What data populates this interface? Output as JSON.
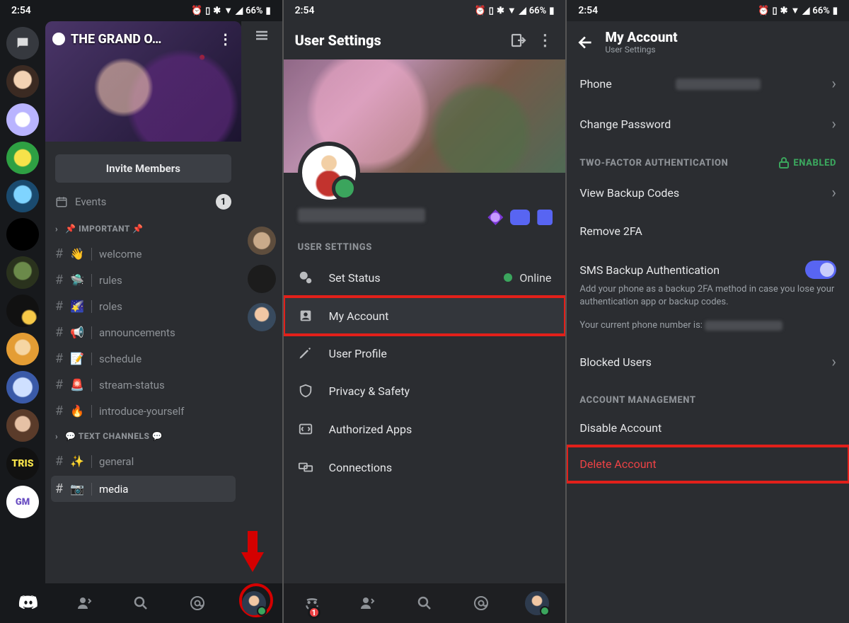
{
  "statusbar": {
    "time": "2:54",
    "battery": "66%",
    "icons": "⏰ ⬚ ✲ ▾◢"
  },
  "panel1": {
    "server_title": "THE GRAND O…",
    "invite": "Invite Members",
    "events_label": "Events",
    "events_count": "1",
    "cat_important": "📌 IMPORTANT 📌",
    "cat_text": "💬 TEXT CHANNELS 💬",
    "ch": {
      "welcome": "welcome",
      "rules": "rules",
      "roles": "roles",
      "announcements": "announcements",
      "schedule": "schedule",
      "stream": "stream-status",
      "intro": "introduce-yourself",
      "general": "general",
      "media": "media"
    },
    "emojis": {
      "welcome": "👋",
      "rules": "🛸",
      "roles": "🌠",
      "announcements": "📢",
      "schedule": "📝",
      "stream": "🚨",
      "intro": "🔥",
      "general": "✨",
      "media": "📷"
    }
  },
  "panel2": {
    "title": "User Settings",
    "section": "USER SETTINGS",
    "rows": {
      "status_label": "Set Status",
      "status_value": "Online",
      "my_account": "My Account",
      "user_profile": "User Profile",
      "privacy": "Privacy & Safety",
      "apps": "Authorized Apps",
      "connections": "Connections"
    },
    "notif": "1"
  },
  "panel3": {
    "title": "My Account",
    "subtitle": "User Settings",
    "rows": {
      "phone": "Phone",
      "change_pw": "Change Password",
      "view_backup": "View Backup Codes",
      "remove_2fa": "Remove 2FA",
      "sms_backup": "SMS Backup Authentication",
      "sms_desc": "Add your phone as a backup 2FA method in case you lose your authentication app or backup codes.",
      "phone_current": "Your current phone number is:",
      "blocked": "Blocked Users",
      "disable": "Disable Account",
      "delete": "Delete Account"
    },
    "sections": {
      "twofa": "TWO-FACTOR AUTHENTICATION",
      "enabled": "ENABLED",
      "acct_mgmt": "ACCOUNT MANAGEMENT"
    }
  }
}
